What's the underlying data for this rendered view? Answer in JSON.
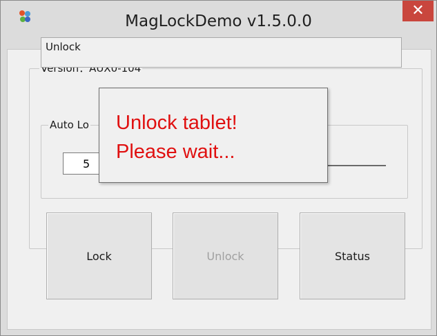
{
  "window": {
    "title": "MagLockDemo v1.5.0.0",
    "close_symbol": "✕",
    "accent_close_color": "#c9463d"
  },
  "version_group": {
    "label": "Version：AUX0-104"
  },
  "status_box": {
    "text": "Unlock"
  },
  "autolock_group": {
    "label": "Auto Lo",
    "value": "5"
  },
  "buttons": {
    "lock_label": "Lock",
    "unlock_label": "Unlock",
    "status_label": "Status"
  },
  "popup": {
    "line1": "Unlock tablet!",
    "line2": "Please wait...",
    "text_color": "#e01010"
  },
  "icons": [
    "app-icon",
    "close-icon"
  ]
}
